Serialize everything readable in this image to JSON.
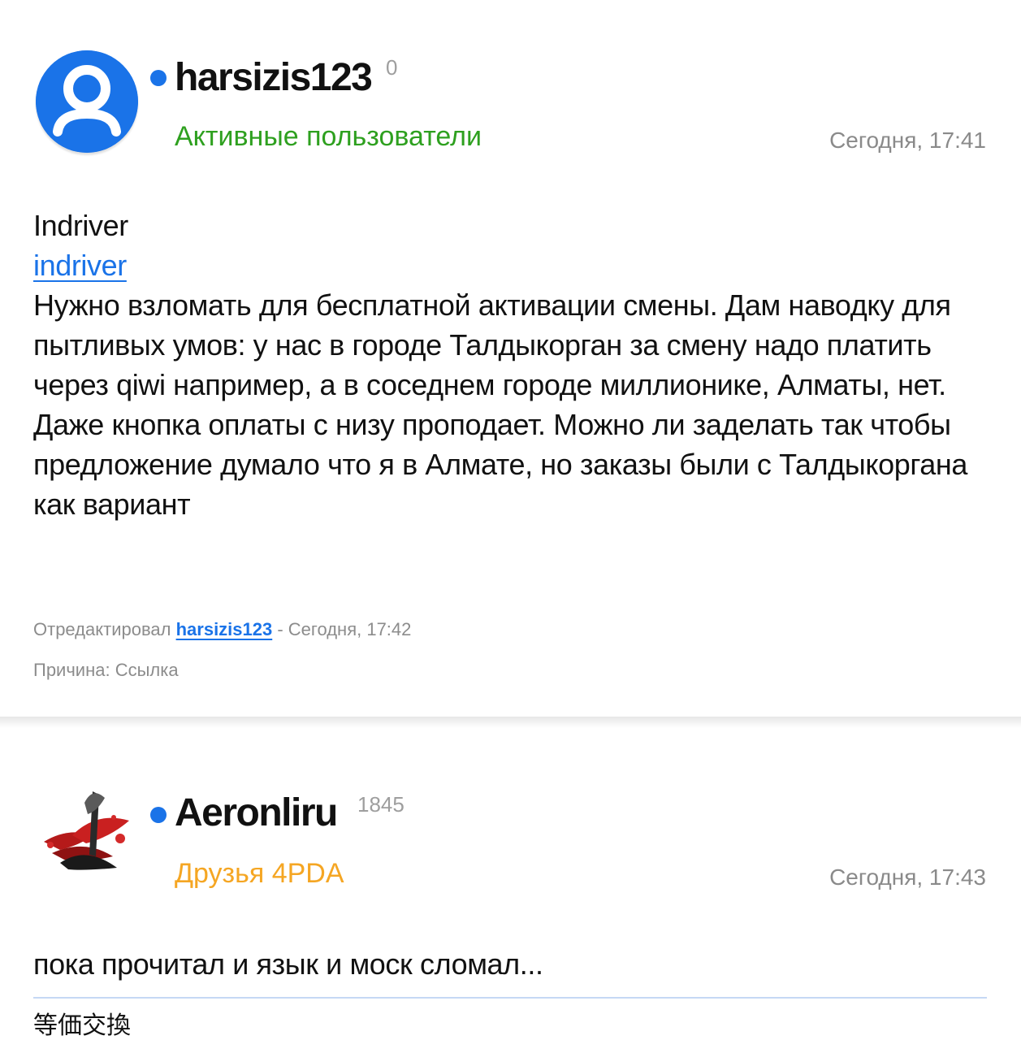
{
  "posts": [
    {
      "author": "harsizis123",
      "reputation": "0",
      "group": "Активные пользователи",
      "group_color": "#2ea01f",
      "time": "Сегодня, 17:41",
      "avatar_icon": "default-user-avatar-icon",
      "body": {
        "title_line": "Indriver",
        "link_text": "indriver",
        "text": "Нужно взломать для бесплатной активации смены. Дам наводку для пытливых умов: у нас в городе Талдыкорган за смену надо платить через qiwi например, а в соседнем городе миллионике, Алматы, нет. Даже кнопка оплаты с низу проподает. Можно ли заделать так чтобы предложение думало что я в Алмате, но заказы были с Талдыкоргана как вариант"
      },
      "edit": {
        "prefix": "Отредактировал",
        "editor": "harsizis123",
        "suffix": "- Сегодня, 17:42",
        "reason": "Причина: Ссылка"
      }
    },
    {
      "author": "Aeronliru",
      "reputation": "1845",
      "group": "Друзья 4PDA",
      "group_color": "#f5a623",
      "time": "Сегодня, 17:43",
      "avatar_icon": "artwork-avatar-icon",
      "body": {
        "text": "пока прочитал и язык и моск сломал..."
      },
      "signature": "等価交換"
    }
  ],
  "colors": {
    "accent": "#1a73e8",
    "online": "#1a73e8",
    "muted": "#8a8a8a",
    "signature_divider": "#c5d8f5"
  }
}
